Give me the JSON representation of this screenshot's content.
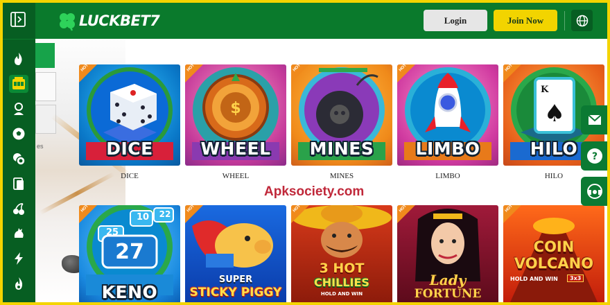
{
  "brand": {
    "name_a": "LUCK",
    "name_b": "BET7"
  },
  "header": {
    "login_label": "Login",
    "join_label": "Join Now"
  },
  "watermark": "Apksociety.com",
  "ghost_text": "es",
  "games": [
    {
      "title": "DICE",
      "caption": "DICE",
      "badge": "HOT"
    },
    {
      "title": "WHEEL",
      "caption": "WHEEL",
      "badge": "HOT"
    },
    {
      "title": "MINES",
      "caption": "MINES",
      "badge": "HOT"
    },
    {
      "title": "LIMBO",
      "caption": "LIMBO",
      "badge": "HOT"
    },
    {
      "title": "HILO",
      "caption": "HILO",
      "badge": "HOT"
    },
    {
      "title": "KENO",
      "badge": "HOT",
      "numbers": [
        "25",
        "10",
        "22",
        "27"
      ]
    },
    {
      "title_a": "SUPER",
      "title_b": "STICKY PIGGY",
      "badge": "HOT"
    },
    {
      "title_a": "3 HOT",
      "title_b": "CHILLIES",
      "sub": "HOLD AND WIN",
      "badge": "HOT"
    },
    {
      "title_a": "Lady",
      "title_b": "FORTUNE",
      "badge": "HOT"
    },
    {
      "title_a": "COIN",
      "title_b": "VOLCANO",
      "sub": "HOLD AND WIN",
      "sub2": "3x3",
      "badge": "HOT"
    }
  ],
  "colors": {
    "sidebar": "#075e22",
    "header": "#0a7a2c",
    "accent": "#f2d400",
    "frame": "#f4d400"
  },
  "sidebar_icons": [
    "panel-toggle-icon",
    "fire-icon",
    "slot-machine-icon",
    "live-dealer-icon",
    "soccer-ball-icon",
    "casino-chip-icon",
    "cards-icon",
    "cherries-icon",
    "rooster-icon",
    "lightning-icon",
    "flame-icon"
  ],
  "right_icons": [
    "mail-icon",
    "help-icon",
    "support-chat-icon"
  ]
}
